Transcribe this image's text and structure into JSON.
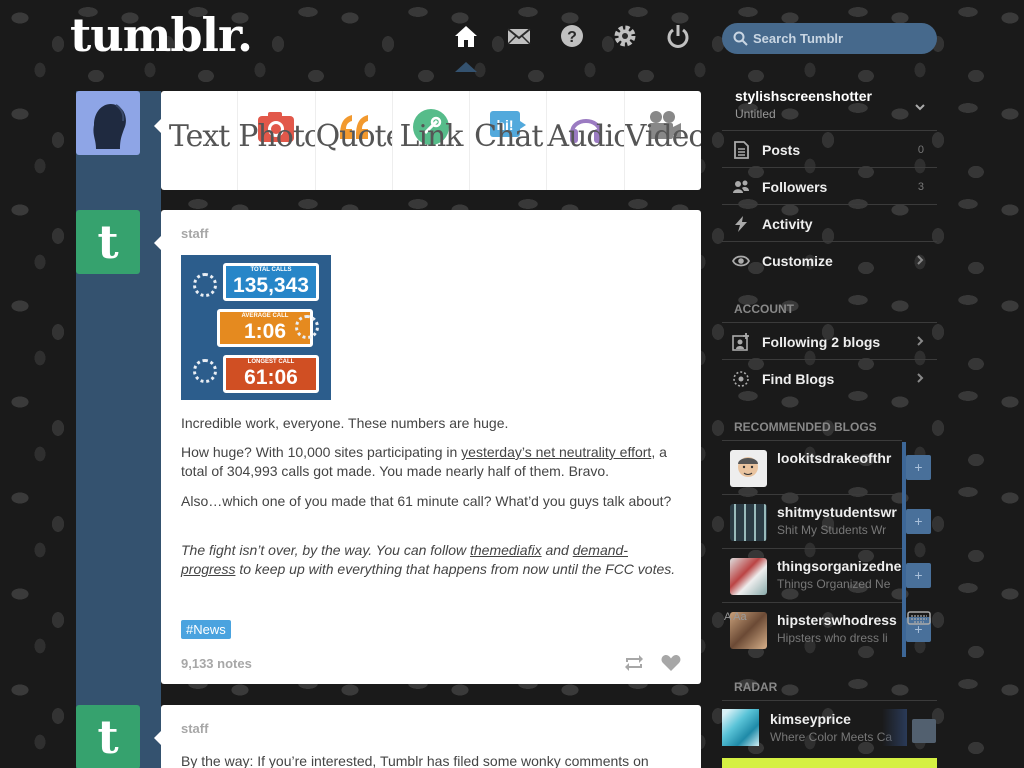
{
  "header": {
    "logo": "tumblr.",
    "nav": [
      {
        "name": "home-icon",
        "active": true
      },
      {
        "name": "mail-icon"
      },
      {
        "name": "help-icon"
      },
      {
        "name": "gear-icon"
      },
      {
        "name": "power-icon"
      }
    ],
    "search_placeholder": "Search Tumblr"
  },
  "post_types": [
    {
      "name": "text",
      "label": "Text"
    },
    {
      "name": "photo",
      "label": "Photo"
    },
    {
      "name": "quote",
      "label": "Quote"
    },
    {
      "name": "link",
      "label": "Link"
    },
    {
      "name": "chat",
      "label": "Chat"
    },
    {
      "name": "audio",
      "label": "Audio"
    },
    {
      "name": "video",
      "label": "Video"
    }
  ],
  "posts": [
    {
      "author": "staff",
      "image": {
        "stats": [
          {
            "label": "TOTAL CALLS",
            "value": "135,343"
          },
          {
            "label": "AVERAGE CALL",
            "value": "1:06"
          },
          {
            "label": "LONGEST CALL",
            "value": "61:06"
          }
        ]
      },
      "p1": "Incredible work, everyone. These numbers are huge.",
      "p2_a": "How huge? With 10,000 sites participating in ",
      "p2_link": "yesterday’s net neutrality effort",
      "p2_b": ", a total of 304,993 calls got made. You made nearly half of them. Bravo.",
      "p3": "Also…which one of you made that 61 minute call? What’d you guys talk about?",
      "p4_a": "The fight isn’t over, by the way. You can follow ",
      "p4_link1": "themediafix",
      "p4_b": " and ",
      "p4_link2": "demand-progress",
      "p4_c": " to keep up with everything that happens from now until the FCC votes.",
      "tag": "#News",
      "notes": "9,133 notes"
    },
    {
      "author": "staff",
      "p1": "By the way: If you’re interested, Tumblr has filed some wonky comments on"
    }
  ],
  "sidebar": {
    "blog_name": "stylishscreenshotter",
    "blog_title": "Untitled",
    "stats": [
      {
        "label": "Posts",
        "count": "0",
        "icon": "posts-icon"
      },
      {
        "label": "Followers",
        "count": "3",
        "icon": "followers-icon"
      },
      {
        "label": "Activity",
        "icon": "activity-icon"
      },
      {
        "label": "Customize",
        "icon": "eye-icon"
      }
    ],
    "account_heading": "ACCOUNT",
    "account": [
      {
        "label": "Following 2 blogs",
        "icon": "following-icon"
      },
      {
        "label": "Find Blogs",
        "icon": "find-blogs-icon"
      }
    ],
    "recommended_heading": "RECOMMENDED BLOGS",
    "recommended": [
      {
        "name": "lookitsdrakeofthr",
        "subtitle": ""
      },
      {
        "name": "shitmystudentswr",
        "subtitle": "Shit My Students Wr"
      },
      {
        "name": "thingsorganizedne",
        "subtitle": "Things Organized Ne"
      },
      {
        "name": "hipsterswhodress",
        "subtitle": "Hipsters who dress li"
      }
    ],
    "overlay_text": "A      Aa",
    "radar_heading": "RADAR",
    "radar": {
      "name": "kimseyprice",
      "subtitle": "Where Color Meets Ca"
    }
  },
  "colors": {
    "accent": "#46698c",
    "column": "#34526f",
    "tag": "#4aa3df",
    "staff": "#36a26e"
  }
}
